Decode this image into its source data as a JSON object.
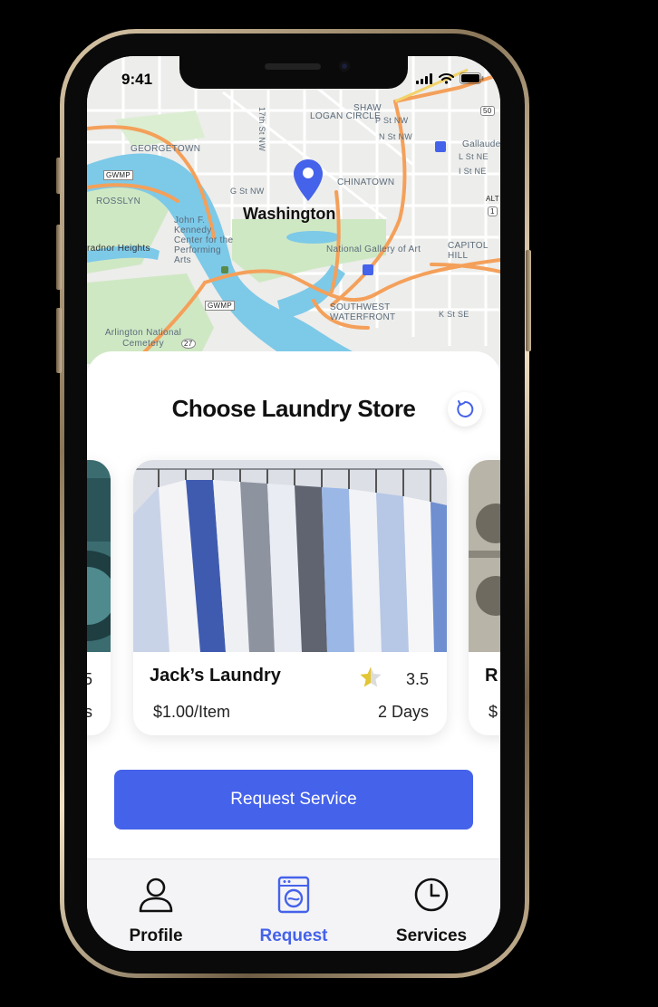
{
  "status_bar": {
    "time": "9:41"
  },
  "map": {
    "city": "Washington",
    "labels": {
      "georgetown": "GEORGETOWN",
      "rosslyn": "ROSSLYN",
      "logan_circle": "LOGAN CIRCLE",
      "chinatown": "CHINATOWN",
      "shaw": "SHAW",
      "kennedy_center": "John F. Kennedy Center for the Performing Arts",
      "national_gallery": "National Gallery of Art",
      "capitol_hill": "CAPITOL HILL",
      "southwest_waterfront": "SOUTHWEST WATERFRONT",
      "arlington_cemetery": "Arlington National Cemetery",
      "arlington_heights": "radnor Heights",
      "gwmp1": "GWMP",
      "gwmp2": "GWMP",
      "g_st": "G St NW",
      "p_st": "P St NW",
      "n_st": "N St NW",
      "l_st": "L St NE",
      "i_st": "I St NE",
      "k_st": "K St SE",
      "seventeenth_st": "17th St NW",
      "gallaudet": "Gallaude",
      "route_50": "50",
      "route_1": "1",
      "route_27": "27",
      "alt": "ALT"
    }
  },
  "sheet": {
    "title": "Choose Laundry Store",
    "stores": [
      {
        "name": "",
        "rating": "5",
        "price": "",
        "days": "s"
      },
      {
        "name": "Jack’s Laundry",
        "rating": "3.5",
        "price": "$1.00/Item",
        "days": "2 Days"
      },
      {
        "name": "R",
        "rating": "",
        "price": "$",
        "days": ""
      }
    ],
    "request_button": "Request Service"
  },
  "tabbar": {
    "tabs": [
      {
        "label": "Profile",
        "icon": "person-icon"
      },
      {
        "label": "Request",
        "icon": "washing-machine-icon"
      },
      {
        "label": "Services",
        "icon": "clock-icon"
      }
    ],
    "active": "Request"
  },
  "colors": {
    "accent": "#4562ea",
    "pin": "#4562ea",
    "water": "#7dc9e8",
    "park": "#cfe8c4",
    "road": "#f4a05a",
    "star": "#e2c633"
  }
}
